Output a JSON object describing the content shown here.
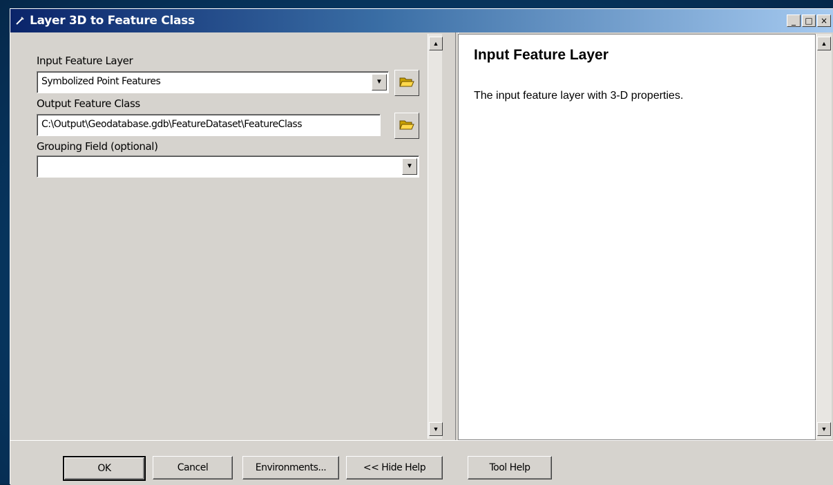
{
  "window": {
    "title": "Layer 3D to Feature Class"
  },
  "titlebar_buttons": {
    "minimize": "_",
    "maximize": "□",
    "close": "×"
  },
  "form": {
    "input_feature_layer": {
      "label": "Input Feature Layer",
      "value": "Symbolized Point Features"
    },
    "output_feature_class": {
      "label": "Output Feature Class",
      "value": "C:\\Output\\Geodatabase.gdb\\FeatureDataset\\FeatureClass"
    },
    "grouping_field": {
      "label": "Grouping Field (optional)",
      "value": ""
    }
  },
  "help": {
    "title": "Input Feature Layer",
    "body": "The input feature layer with 3-D properties."
  },
  "buttons": {
    "ok": "OK",
    "cancel": "Cancel",
    "environments": "Environments...",
    "hide_help": "<< Hide Help",
    "tool_help": "Tool Help"
  }
}
